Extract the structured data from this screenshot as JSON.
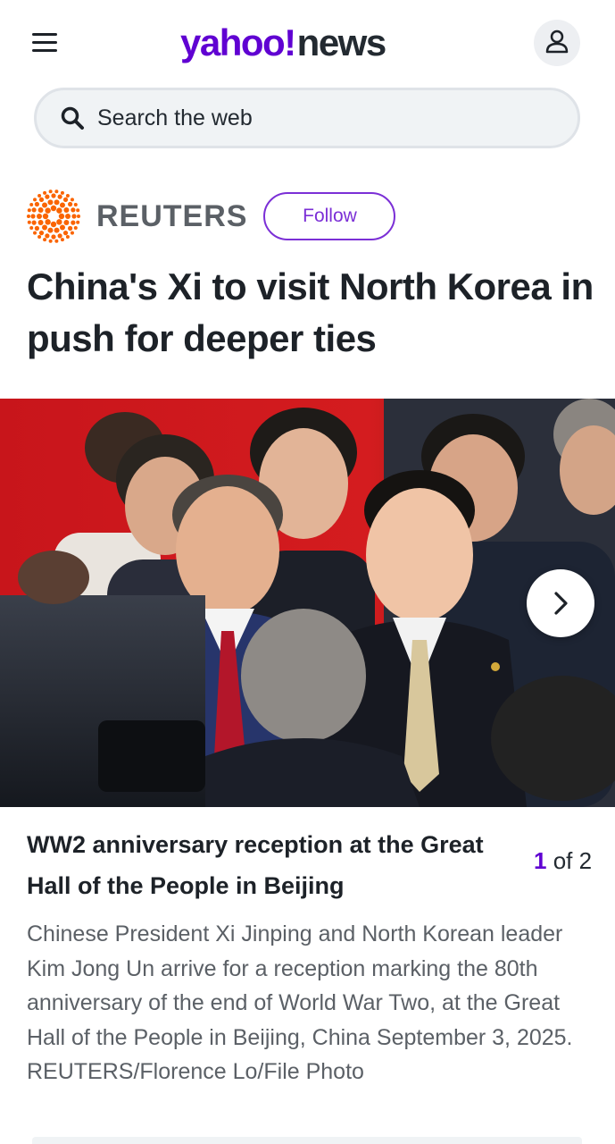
{
  "header": {
    "menu_icon": "hamburger-menu-icon",
    "logo_yahoo": "yahoo!",
    "logo_news": "news",
    "profile_icon": "user-profile-icon",
    "brand_color": "#6001d2"
  },
  "search": {
    "placeholder": "Search the web",
    "icon": "search-icon"
  },
  "article": {
    "provider": "REUTERS",
    "provider_logo": "reuters-dot-logo",
    "follow_label": "Follow",
    "headline": "China's Xi to visit North Korea in push for deeper ties"
  },
  "slideshow": {
    "next_icon": "chevron-right-icon",
    "current": "1",
    "of_label": "of 2",
    "caption_title": "WW2 anniversary reception at the Great Hall of the People in Beijing",
    "caption_body": "Chinese President Xi Jinping and North Korean leader Kim Jong Un arrive for a reception marking the 80th anniversary of the end of World War Two, at the Great Hall of the People in Beijing, China September 3, 2025. REUTERS/Florence Lo/File Photo"
  }
}
